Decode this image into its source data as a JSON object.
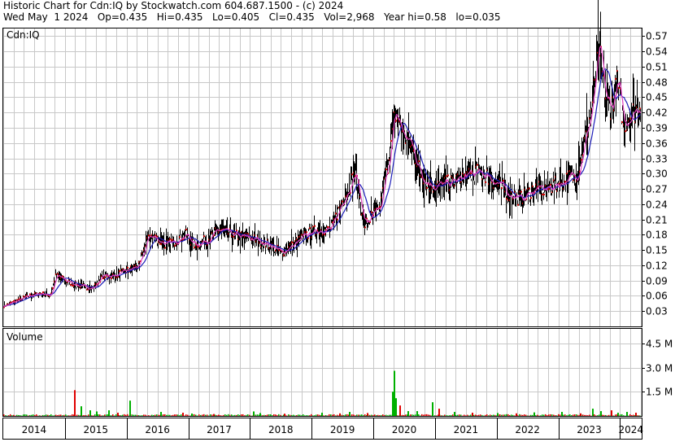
{
  "header": {
    "line1": "Historic Chart for Cdn:IQ by Stockwatch.com 604.687.1500 - (c) 2024",
    "line2": "Wed May  1 2024   Op=0.435   Hi=0.435   Lo=0.405   Cl=0.435   Vol=2,968   Year hi=0.58   lo=0.035"
  },
  "price_panel": {
    "label": "Cdn:IQ"
  },
  "volume_panel": {
    "label": "Volume"
  },
  "colors": {
    "grid": "#c8c8c8",
    "price_bars": "#000000",
    "close_marks": "#cc0000",
    "ma_short": "#e040c0",
    "ma_long": "#1c1cb8",
    "volume_up": "#00b000",
    "volume_down": "#e00000"
  },
  "chart_data": [
    {
      "type": "line",
      "title": "Cdn:IQ",
      "x_ticks": [
        "2014",
        "2015",
        "2016",
        "2017",
        "2018",
        "2019",
        "2020",
        "2021",
        "2022",
        "2023",
        "2024"
      ],
      "y_ticks": [
        "0.57",
        "0.54",
        "0.51",
        "0.48",
        "0.45",
        "0.42",
        "0.39",
        "0.36",
        "0.33",
        "0.30",
        "0.27",
        "0.24",
        "0.21",
        "0.18",
        "0.15",
        "0.12",
        "0.09",
        "0.06",
        "0.03"
      ],
      "ylim": [
        0.0,
        0.585
      ],
      "xlim": [
        2014.0,
        2024.35
      ],
      "grid": true,
      "series": [
        {
          "x": [
            2014.0,
            2014.2,
            2014.4,
            2014.6,
            2014.75,
            2014.85,
            2015.0,
            2015.2,
            2015.45,
            2015.6,
            2015.8,
            2016.0,
            2016.2,
            2016.35,
            2016.5,
            2016.65,
            2016.8,
            2016.95,
            2017.1,
            2017.3,
            2017.5,
            2017.7,
            2017.9,
            2018.1,
            2018.3,
            2018.5,
            2018.7,
            2018.9,
            2019.1,
            2019.3,
            2019.5,
            2019.7,
            2019.85,
            2020.0,
            2020.1,
            2020.2,
            2020.35,
            2020.5,
            2020.6,
            2020.75,
            2020.9,
            2021.0,
            2021.2,
            2021.4,
            2021.6,
            2021.8,
            2022.0,
            2022.2,
            2022.4,
            2022.6,
            2022.8,
            2023.0,
            2023.15,
            2023.3,
            2023.45,
            2023.55,
            2023.65,
            2023.75,
            2023.85,
            2023.95,
            2024.05,
            2024.2,
            2024.33
          ],
          "values": [
            0.04,
            0.05,
            0.06,
            0.065,
            0.06,
            0.1,
            0.09,
            0.08,
            0.075,
            0.1,
            0.1,
            0.11,
            0.12,
            0.18,
            0.17,
            0.16,
            0.17,
            0.18,
            0.16,
            0.17,
            0.19,
            0.18,
            0.175,
            0.17,
            0.16,
            0.145,
            0.16,
            0.18,
            0.19,
            0.19,
            0.25,
            0.3,
            0.2,
            0.22,
            0.23,
            0.3,
            0.42,
            0.37,
            0.36,
            0.3,
            0.28,
            0.275,
            0.28,
            0.29,
            0.3,
            0.3,
            0.28,
            0.26,
            0.25,
            0.27,
            0.27,
            0.28,
            0.29,
            0.3,
            0.38,
            0.44,
            0.55,
            0.45,
            0.43,
            0.48,
            0.4,
            0.42,
            0.435
          ]
        }
      ]
    },
    {
      "type": "bar",
      "title": "Volume",
      "y_ticks": [
        "4.5 M",
        "3.0 M",
        "1.5 M"
      ],
      "ylim": [
        0,
        5400000
      ],
      "bars": [
        {
          "x": 2015.15,
          "value": 1600000,
          "dir": "down"
        },
        {
          "x": 2015.25,
          "value": 600000,
          "dir": "up"
        },
        {
          "x": 2015.4,
          "value": 350000,
          "dir": "up"
        },
        {
          "x": 2015.5,
          "value": 280000,
          "dir": "up"
        },
        {
          "x": 2015.7,
          "value": 350000,
          "dir": "up"
        },
        {
          "x": 2015.85,
          "value": 200000,
          "dir": "down"
        },
        {
          "x": 2016.05,
          "value": 950000,
          "dir": "up"
        },
        {
          "x": 2016.55,
          "value": 250000,
          "dir": "up"
        },
        {
          "x": 2016.9,
          "value": 200000,
          "dir": "down"
        },
        {
          "x": 2017.05,
          "value": 150000,
          "dir": "up"
        },
        {
          "x": 2017.4,
          "value": 120000,
          "dir": "down"
        },
        {
          "x": 2018.05,
          "value": 280000,
          "dir": "up"
        },
        {
          "x": 2018.15,
          "value": 180000,
          "dir": "up"
        },
        {
          "x": 2018.55,
          "value": 140000,
          "dir": "down"
        },
        {
          "x": 2019.15,
          "value": 200000,
          "dir": "up"
        },
        {
          "x": 2019.45,
          "value": 160000,
          "dir": "down"
        },
        {
          "x": 2019.6,
          "value": 250000,
          "dir": "up"
        },
        {
          "x": 2019.9,
          "value": 180000,
          "dir": "down"
        },
        {
          "x": 2020.3,
          "value": 1500000,
          "dir": "up"
        },
        {
          "x": 2020.33,
          "value": 2800000,
          "dir": "up"
        },
        {
          "x": 2020.36,
          "value": 1100000,
          "dir": "up"
        },
        {
          "x": 2020.42,
          "value": 650000,
          "dir": "down"
        },
        {
          "x": 2020.55,
          "value": 300000,
          "dir": "up"
        },
        {
          "x": 2020.7,
          "value": 300000,
          "dir": "up"
        },
        {
          "x": 2020.95,
          "value": 850000,
          "dir": "up"
        },
        {
          "x": 2021.05,
          "value": 450000,
          "dir": "down"
        },
        {
          "x": 2021.3,
          "value": 250000,
          "dir": "up"
        },
        {
          "x": 2021.6,
          "value": 200000,
          "dir": "down"
        },
        {
          "x": 2022.0,
          "value": 180000,
          "dir": "up"
        },
        {
          "x": 2022.3,
          "value": 160000,
          "dir": "down"
        },
        {
          "x": 2022.6,
          "value": 220000,
          "dir": "up"
        },
        {
          "x": 2023.05,
          "value": 250000,
          "dir": "up"
        },
        {
          "x": 2023.35,
          "value": 160000,
          "dir": "down"
        },
        {
          "x": 2023.55,
          "value": 450000,
          "dir": "up"
        },
        {
          "x": 2023.68,
          "value": 300000,
          "dir": "up"
        },
        {
          "x": 2023.85,
          "value": 350000,
          "dir": "down"
        },
        {
          "x": 2023.95,
          "value": 200000,
          "dir": "up"
        },
        {
          "x": 2024.1,
          "value": 250000,
          "dir": "up"
        },
        {
          "x": 2024.25,
          "value": 200000,
          "dir": "down"
        }
      ]
    }
  ]
}
